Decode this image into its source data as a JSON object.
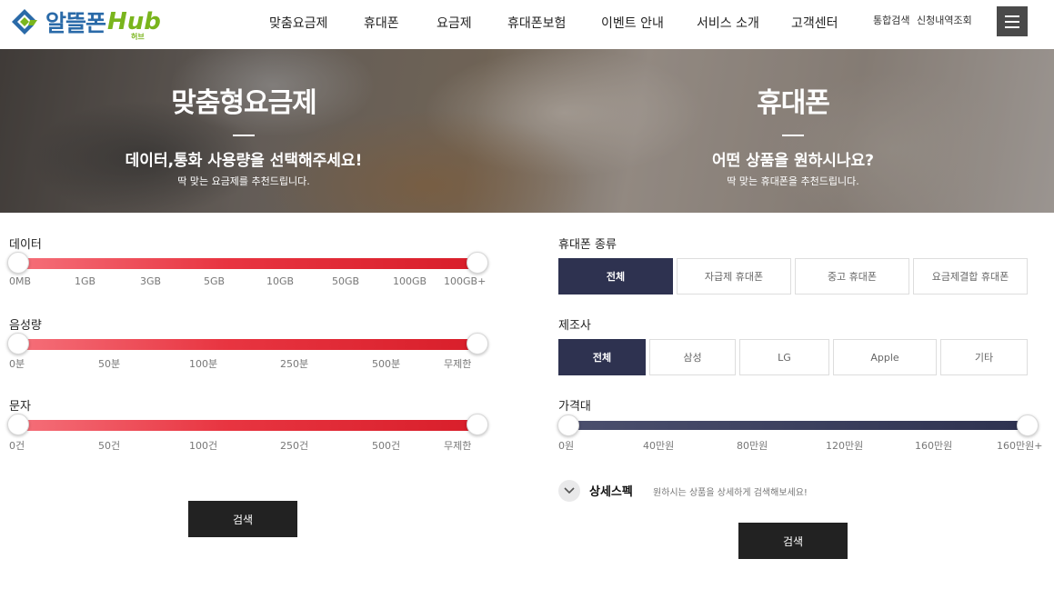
{
  "header": {
    "logo": {
      "main": "알뜰폰",
      "hub": "Hub",
      "hub_sub": "허브"
    },
    "nav": [
      "맞춤요금제",
      "휴대폰",
      "요금제",
      "휴대폰보험",
      "이벤트 안내",
      "서비스 소개",
      "고객센터"
    ],
    "util": [
      "통합검색",
      "신청내역조회"
    ],
    "menu_icon": "hamburger-icon"
  },
  "banner": {
    "left": {
      "title": "맞춤형요금제",
      "sub": "데이터,통화 사용량을 선택해주세요!",
      "small": "딱 맞는 요금제를 추천드립니다."
    },
    "right": {
      "title": "휴대폰",
      "sub": "어떤 상품을 원하시나요?",
      "small": "딱 맞는 휴대폰을 추천드립니다."
    }
  },
  "plan": {
    "data": {
      "label": "데이터",
      "ticks": [
        "0MB",
        "1GB",
        "3GB",
        "5GB",
        "10GB",
        "50GB",
        "100GB",
        "100GB+"
      ]
    },
    "voice": {
      "label": "음성량",
      "ticks": [
        "0분",
        "50분",
        "100분",
        "250분",
        "500분",
        "무제한"
      ]
    },
    "sms": {
      "label": "문자",
      "ticks": [
        "0건",
        "50건",
        "100건",
        "250건",
        "500건",
        "무제한"
      ]
    },
    "search": "검색"
  },
  "phone": {
    "type": {
      "label": "휴대폰 종류",
      "options": [
        "전체",
        "자급제 휴대폰",
        "중고 휴대폰",
        "요금제결합 휴대폰"
      ]
    },
    "maker": {
      "label": "제조사",
      "options": [
        "전체",
        "삼성",
        "LG",
        "Apple",
        "기타"
      ]
    },
    "price": {
      "label": "가격대",
      "ticks": [
        "0원",
        "40만원",
        "80만원",
        "120만원",
        "160만원",
        "160만원+"
      ]
    },
    "detail": {
      "label": "상세스펙",
      "desc": "원하시는 상품을 상세하게 검색해보세요!"
    },
    "search": "검색"
  },
  "colors": {
    "accent_red": "#e1252f",
    "navy": "#2e3250",
    "button_dark": "#222222",
    "logo_blue": "#2a6aa8",
    "logo_green": "#7ab51d"
  }
}
